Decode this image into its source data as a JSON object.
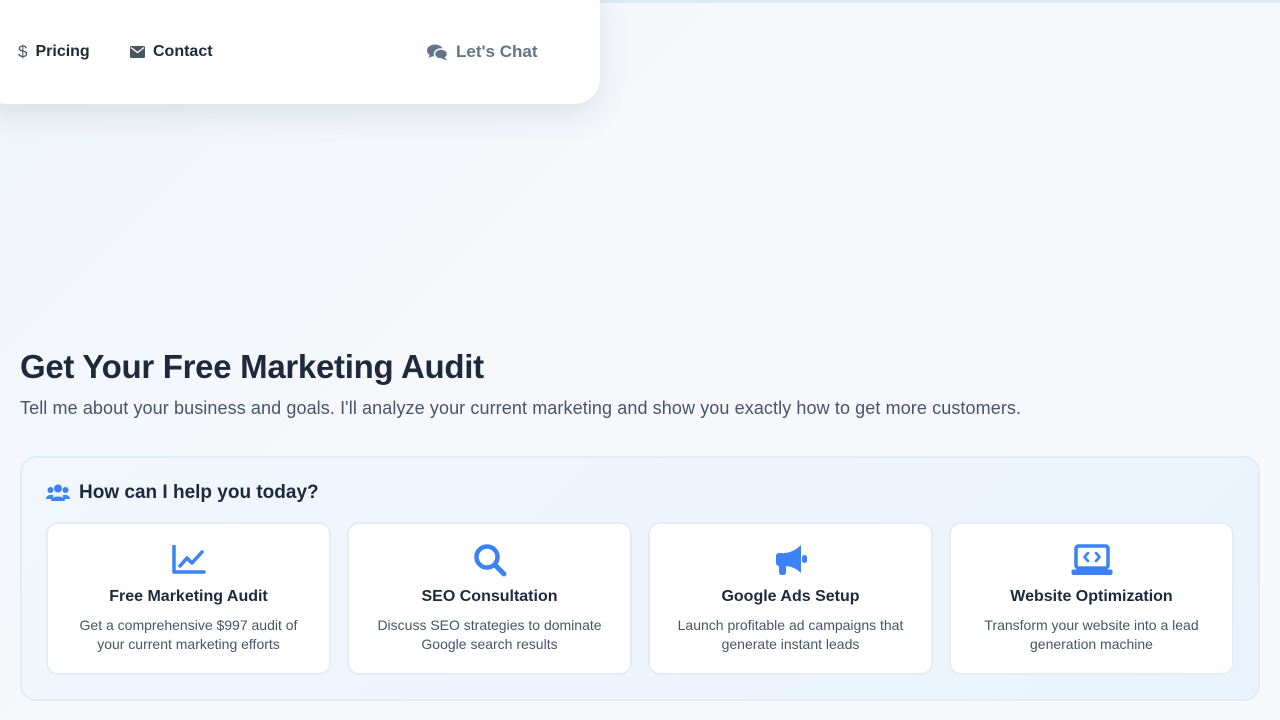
{
  "nav": {
    "items": [
      {
        "label": "Pricing",
        "icon": "dollar-icon"
      },
      {
        "label": "Contact",
        "icon": "envelope-icon"
      }
    ],
    "chat": {
      "label": "Let's Chat",
      "icon": "comments-icon"
    }
  },
  "hero": {
    "title": "Get Your Free Marketing Audit",
    "subtitle": "Tell me about your business and goals. I'll analyze your current marketing and show you exactly how to get more customers."
  },
  "help": {
    "title": "How can I help you today?",
    "icon": "users-icon",
    "options": [
      {
        "title": "Free Marketing Audit",
        "description": "Get a comprehensive $997 audit of your current marketing efforts",
        "icon": "chart-line-icon"
      },
      {
        "title": "SEO Consultation",
        "description": "Discuss SEO strategies to dominate Google search results",
        "icon": "search-icon"
      },
      {
        "title": "Google Ads Setup",
        "description": "Launch profitable ad campaigns that generate instant leads",
        "icon": "megaphone-icon"
      },
      {
        "title": "Website Optimization",
        "description": "Transform your website into a lead generation machine",
        "icon": "laptop-code-icon"
      }
    ]
  },
  "colors": {
    "accent": "#3b82f6",
    "heading": "#1e293b",
    "body_text": "#475569",
    "muted": "#64748b"
  }
}
